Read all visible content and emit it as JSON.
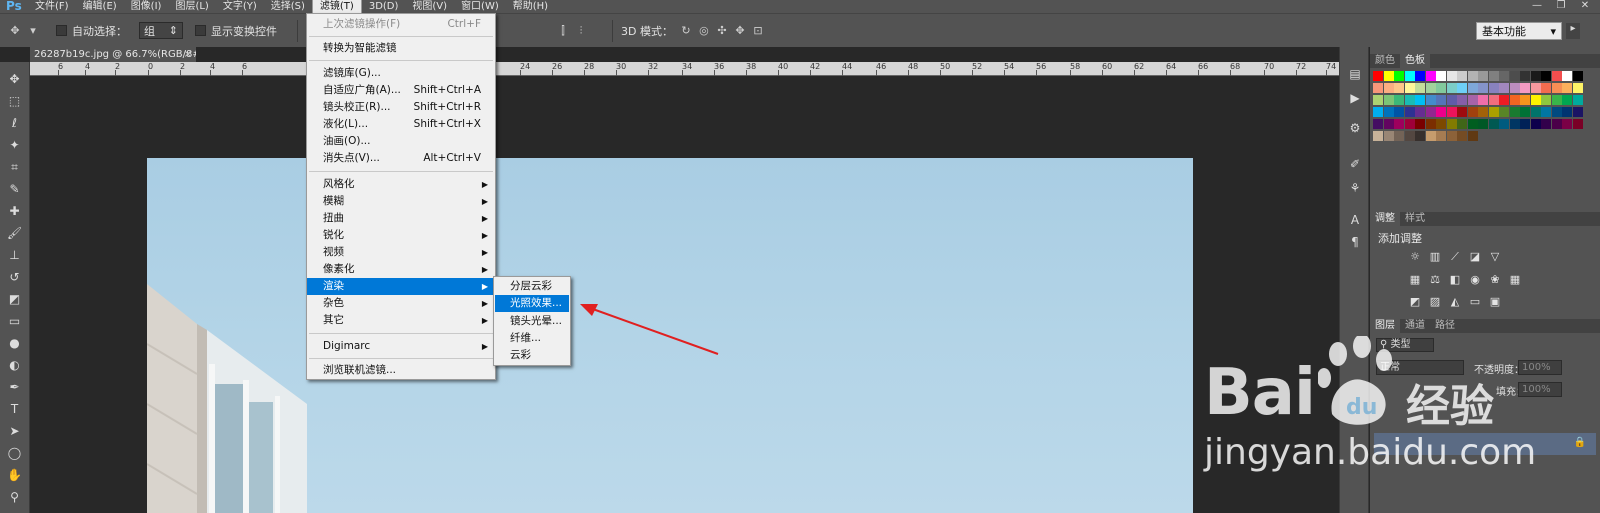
{
  "app": {
    "logo": "Ps"
  },
  "menubar": {
    "items": [
      "文件(F)",
      "编辑(E)",
      "图像(I)",
      "图层(L)",
      "文字(Y)",
      "选择(S)",
      "滤镜(T)",
      "3D(D)",
      "视图(V)",
      "窗口(W)",
      "帮助(H)"
    ],
    "active": "滤镜(T)"
  },
  "options": {
    "auto_select_label": "自动选择：",
    "auto_select_value": "组",
    "show_transform_label": "显示变换控件",
    "mode_3d_label": "3D 模式：",
    "workspace": "基本功能"
  },
  "document": {
    "tab_title": "26287b19c.jpg @ 66.7%(RGB/8#)",
    "ruler_ticks": [
      "6",
      "4",
      "2",
      "0",
      "2",
      "4",
      "6",
      "24",
      "26",
      "28",
      "30",
      "32",
      "34",
      "36",
      "38",
      "40",
      "42",
      "44",
      "46",
      "48",
      "50",
      "52",
      "54",
      "56",
      "58",
      "60",
      "62",
      "64",
      "66",
      "68",
      "70",
      "72",
      "74"
    ]
  },
  "filter_menu": {
    "last_filter": {
      "label": "上次滤镜操作(F)",
      "shortcut": "Ctrl+F"
    },
    "smart": "转换为智能滤镜",
    "items_a": [
      {
        "label": "滤镜库(G)...",
        "shortcut": ""
      },
      {
        "label": "自适应广角(A)...",
        "shortcut": "Shift+Ctrl+A"
      },
      {
        "label": "镜头校正(R)...",
        "shortcut": "Shift+Ctrl+R"
      },
      {
        "label": "液化(L)...",
        "shortcut": "Shift+Ctrl+X"
      },
      {
        "label": "油画(O)...",
        "shortcut": ""
      },
      {
        "label": "消失点(V)...",
        "shortcut": "Alt+Ctrl+V"
      }
    ],
    "items_b": [
      "风格化",
      "模糊",
      "扭曲",
      "锐化",
      "视频",
      "像素化",
      "渲染",
      "杂色",
      "其它"
    ],
    "highlighted": "渲染",
    "digimarc": "Digimarc",
    "browse": "浏览联机滤镜..."
  },
  "render_submenu": {
    "items": [
      "分层云彩",
      "光照效果...",
      "镜头光晕...",
      "纤维...",
      "云彩"
    ],
    "highlighted": "光照效果..."
  },
  "panels": {
    "swatch_tabs": [
      "颜色",
      "色板"
    ],
    "adjust_tabs": [
      "调整",
      "样式"
    ],
    "adjust_title": "添加调整",
    "layer_tabs": [
      "图层",
      "通道",
      "路径"
    ],
    "layer_filter": "类型",
    "blend_mode": "正常",
    "opacity_label": "不透明度：",
    "opacity_value": "100%",
    "fill_label": "填充：",
    "fill_value": "100%"
  },
  "watermark": {
    "brand": "Bai",
    "brand_cn": "经验",
    "url": "jingyan.baidu.com"
  },
  "colors": {
    "highlight": "#0078d7",
    "arrow": "#e02020",
    "panel": "#535353"
  }
}
